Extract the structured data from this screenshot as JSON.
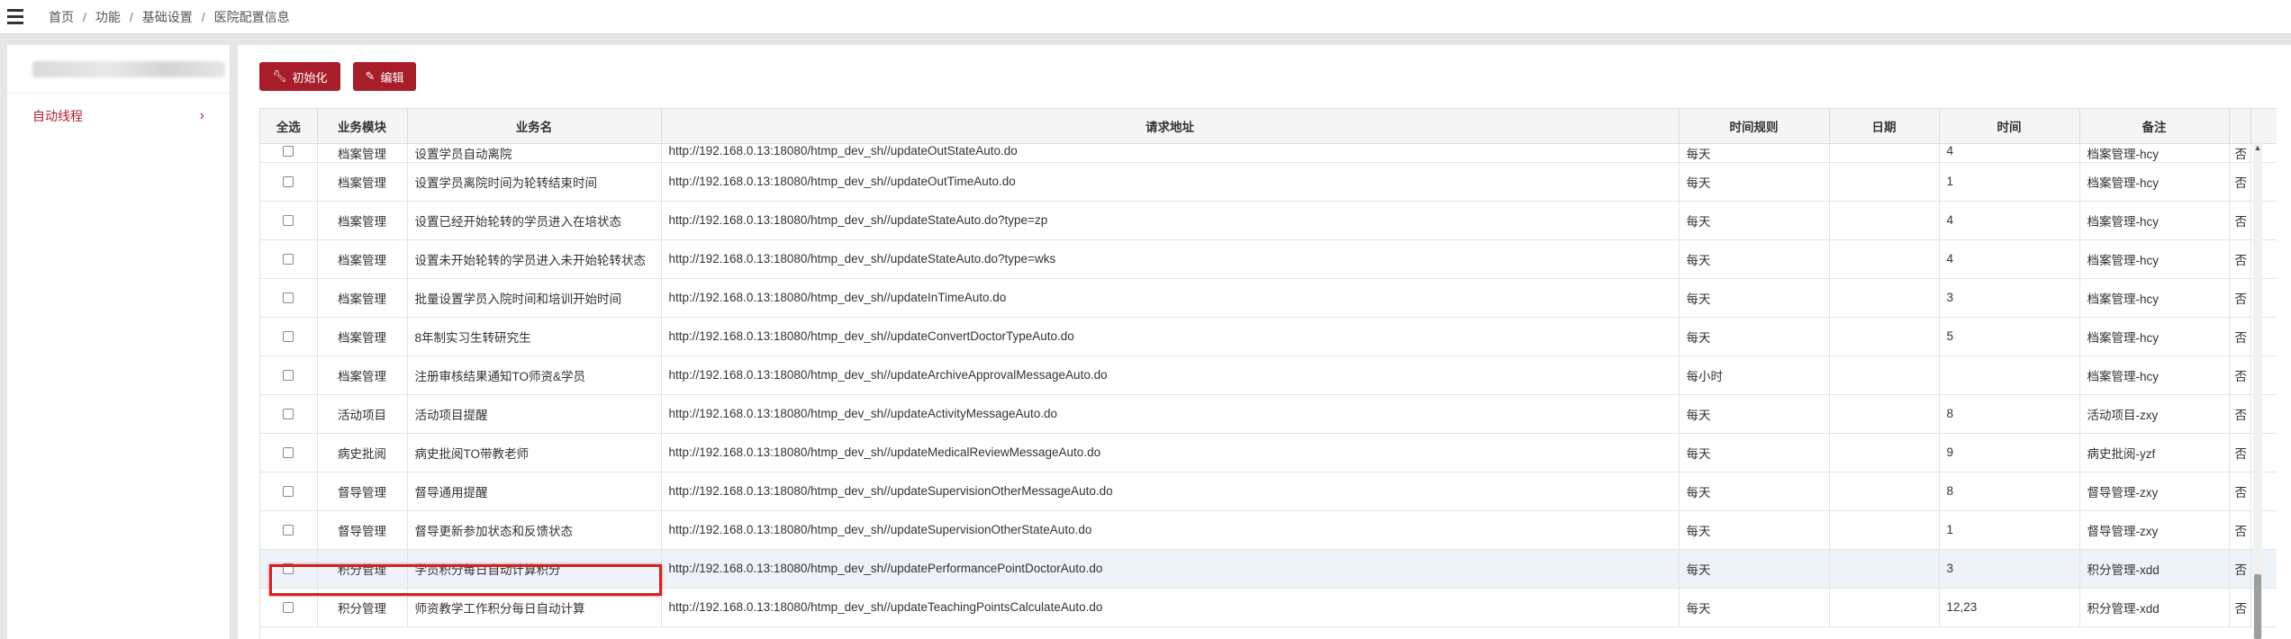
{
  "breadcrumb": [
    "首页",
    "功能",
    "基础设置",
    "医院配置信息"
  ],
  "sidebar": {
    "items": [
      {
        "label": "自动线程"
      }
    ]
  },
  "toolbar": {
    "init_label": "初始化",
    "edit_label": "编辑"
  },
  "table": {
    "headers": [
      "全选",
      "业务模块",
      "业务名",
      "请求地址",
      "时间规则",
      "日期",
      "时间",
      "备注",
      "",
      ""
    ],
    "rows": [
      {
        "module": "档案管理",
        "name": "设置学员自动离院",
        "url": "http://192.168.0.13:18080/htmp_dev_sh//updateOutStateAuto.do",
        "rule": "每天",
        "date": "",
        "time": "4",
        "remark": "档案管理-hcy",
        "extra": "否"
      },
      {
        "module": "档案管理",
        "name": "设置学员离院时间为轮转结束时间",
        "url": "http://192.168.0.13:18080/htmp_dev_sh//updateOutTimeAuto.do",
        "rule": "每天",
        "date": "",
        "time": "1",
        "remark": "档案管理-hcy",
        "extra": "否"
      },
      {
        "module": "档案管理",
        "name": "设置已经开始轮转的学员进入在培状态",
        "url": "http://192.168.0.13:18080/htmp_dev_sh//updateStateAuto.do?type=zp",
        "rule": "每天",
        "date": "",
        "time": "4",
        "remark": "档案管理-hcy",
        "extra": "否"
      },
      {
        "module": "档案管理",
        "name": "设置未开始轮转的学员进入未开始轮转状态",
        "url": "http://192.168.0.13:18080/htmp_dev_sh//updateStateAuto.do?type=wks",
        "rule": "每天",
        "date": "",
        "time": "4",
        "remark": "档案管理-hcy",
        "extra": "否"
      },
      {
        "module": "档案管理",
        "name": "批量设置学员入院时间和培训开始时间",
        "url": "http://192.168.0.13:18080/htmp_dev_sh//updateInTimeAuto.do",
        "rule": "每天",
        "date": "",
        "time": "3",
        "remark": "档案管理-hcy",
        "extra": "否"
      },
      {
        "module": "档案管理",
        "name": "8年制实习生转研究生",
        "url": "http://192.168.0.13:18080/htmp_dev_sh//updateConvertDoctorTypeAuto.do",
        "rule": "每天",
        "date": "",
        "time": "5",
        "remark": "档案管理-hcy",
        "extra": "否"
      },
      {
        "module": "档案管理",
        "name": "注册审核结果通知TO师资&学员",
        "url": "http://192.168.0.13:18080/htmp_dev_sh//updateArchiveApprovalMessageAuto.do",
        "rule": "每小时",
        "date": "",
        "time": "",
        "remark": "档案管理-hcy",
        "extra": "否"
      },
      {
        "module": "活动项目",
        "name": "活动项目提醒",
        "url": "http://192.168.0.13:18080/htmp_dev_sh//updateActivityMessageAuto.do",
        "rule": "每天",
        "date": "",
        "time": "8",
        "remark": "活动项目-zxy",
        "extra": "否"
      },
      {
        "module": "病史批阅",
        "name": "病史批阅TO带教老师",
        "url": "http://192.168.0.13:18080/htmp_dev_sh//updateMedicalReviewMessageAuto.do",
        "rule": "每天",
        "date": "",
        "time": "9",
        "remark": "病史批阅-yzf",
        "extra": "否"
      },
      {
        "module": "督导管理",
        "name": "督导通用提醒",
        "url": "http://192.168.0.13:18080/htmp_dev_sh//updateSupervisionOtherMessageAuto.do",
        "rule": "每天",
        "date": "",
        "time": "8",
        "remark": "督导管理-zxy",
        "extra": "否"
      },
      {
        "module": "督导管理",
        "name": "督导更新参加状态和反馈状态",
        "url": "http://192.168.0.13:18080/htmp_dev_sh//updateSupervisionOtherStateAuto.do",
        "rule": "每天",
        "date": "",
        "time": "1",
        "remark": "督导管理-zxy",
        "extra": "否"
      },
      {
        "module": "积分管理",
        "name": "学员积分每日自动计算积分",
        "url": "http://192.168.0.13:18080/htmp_dev_sh//updatePerformancePointDoctorAuto.do",
        "rule": "每天",
        "date": "",
        "time": "3",
        "remark": "积分管理-xdd",
        "extra": "否"
      },
      {
        "module": "积分管理",
        "name": "师资教学工作积分每日自动计算",
        "url": "http://192.168.0.13:18080/htmp_dev_sh//updateTeachingPointsCalculateAuto.do",
        "rule": "每天",
        "date": "",
        "time": "12,23",
        "remark": "积分管理-xdd",
        "extra": "否"
      }
    ]
  },
  "colors": {
    "accent": "#a71d2a",
    "sidebar_active": "#b0242f",
    "highlight_border": "#d42020"
  }
}
